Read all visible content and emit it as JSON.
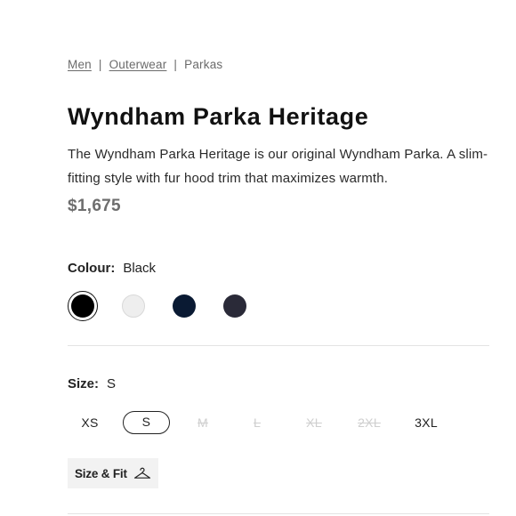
{
  "breadcrumb": {
    "items": [
      {
        "label": "Men",
        "link": true
      },
      {
        "label": "Outerwear",
        "link": true
      },
      {
        "label": "Parkas",
        "link": false
      }
    ],
    "separator": "|"
  },
  "product": {
    "title": "Wyndham Parka Heritage",
    "description": "The Wyndham Parka Heritage is our original Wyndham Parka. A slim-fitting style with fur hood trim that maximizes warmth.",
    "price": "$1,675"
  },
  "colour": {
    "label": "Colour:",
    "selected": "Black",
    "swatches": [
      {
        "name": "Black",
        "hex": "#000000",
        "selected": true
      },
      {
        "name": "White",
        "hex": "#eeeeee",
        "selected": false
      },
      {
        "name": "Navy",
        "hex": "#0a1a33",
        "selected": false
      },
      {
        "name": "Charcoal",
        "hex": "#2a2a38",
        "selected": false
      }
    ]
  },
  "size": {
    "label": "Size:",
    "selected": "S",
    "options": [
      {
        "label": "XS",
        "available": true,
        "selected": false
      },
      {
        "label": "S",
        "available": true,
        "selected": true
      },
      {
        "label": "M",
        "available": false,
        "selected": false
      },
      {
        "label": "L",
        "available": false,
        "selected": false
      },
      {
        "label": "XL",
        "available": false,
        "selected": false
      },
      {
        "label": "2XL",
        "available": false,
        "selected": false
      },
      {
        "label": "3XL",
        "available": true,
        "selected": false
      }
    ]
  },
  "size_fit": {
    "label": "Size & Fit",
    "icon": "hanger-icon"
  },
  "colors": {
    "text": "#1b1b1b",
    "muted": "#6e6e6e",
    "divider": "#e3e3e3",
    "button_bg": "#f2f2f2",
    "unavailable": "#cfcfcf"
  }
}
